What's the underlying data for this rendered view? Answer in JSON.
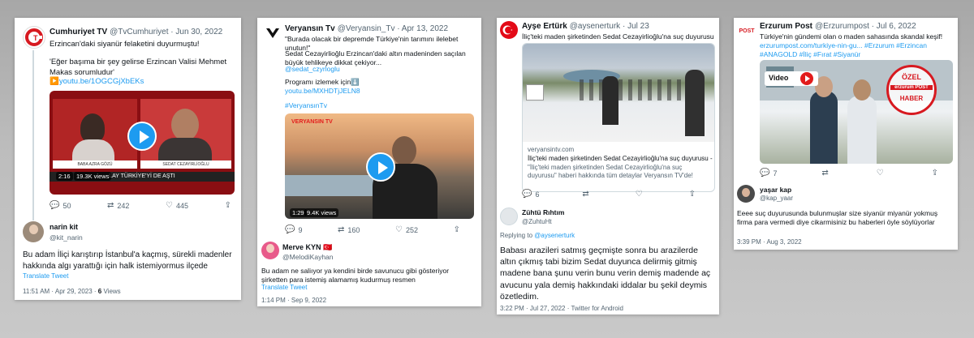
{
  "card1": {
    "name": "Cumhuriyet TV",
    "handle": "@TvCumhuriyet",
    "date": "· Jun 30, 2022",
    "text1": "Erzincan'daki siyanür felaketini duyurmuştu!",
    "text2": "'Eğer başıma bir şey gelirse Erzincan Valisi Mehmet Makas sorumludur'",
    "link": "▶️youtu.be/1OGCGjXbEKs",
    "video_time": "2:16",
    "video_views": "19.3K views",
    "banner_left": "BABA AZRA GÖZÜ",
    "banner_right": "SEDAT CEZAYİRLİOĞLU",
    "ticker": "LAY TÜRKİYE'Yİ DE AŞTI",
    "replies": "50",
    "retweets": "242",
    "likes": "445",
    "reply_name": "narin kit",
    "reply_handle": "@kit_narin",
    "reply_text": "Bu adam İliçi karıştırıp İstanbul'a kaçmış, sürekli madenler hakkında algı yarattığı için halk istemiyormus ilçede",
    "translate": "Translate Tweet",
    "reply_time": "11:51 AM · Apr 29, 2023 · ",
    "reply_views_count": "6",
    "reply_views_label": " Views"
  },
  "card2": {
    "name": "Veryansın Tv",
    "handle": "@Veryansin_Tv",
    "date": "· Apr 13, 2022",
    "quote": "\"Burada olacak bir depremde Türkiye'nin tarımını ilelebet unutun!\"",
    "text": "Sedat Cezayirlioğlu Erzincan'daki altın madeninden saçılan büyük tehlikeye dikkat çekiyor...",
    "mention": "@sedat_czyrloglu",
    "program": "Programı izlemek için⬇️",
    "link": "youtu.be/MXHDTjJELN8",
    "hashtag": "#VeryansınTv",
    "watermark": "VERYANSIN TV",
    "video_time": "1:29",
    "video_views": "9.4K views",
    "replies": "9",
    "retweets": "160",
    "likes": "252",
    "reply_name": "Merve KYN 🇹🇷",
    "reply_handle": "@MelodiKayhan",
    "reply_text": "Bu adam ne saliıyor ya kendini birde savunucu gibi gösteriyor şirketten para istemiş alamamış kudurmuş resmen",
    "translate": "Translate Tweet",
    "reply_time": "1:14 PM · Sep 9, 2022"
  },
  "card3": {
    "name": "Ayşe Ertürk",
    "handle": "@aysenerturk",
    "date": "· Jul 23",
    "text": "İliç'teki maden şirketinden Sedat Cezayirlioğlu'na suç duyurusu",
    "link_domain": "veryansintv.com",
    "link_title": "İliç'teki maden şirketinden Sedat Cezayirlioğlu'na suç duyurusu - ...",
    "link_desc": "\"İliç'teki maden şirketinden Sedat Cezayirlioğlu'na suç duyurusu\" haberi hakkında tüm detaylar Veryansın TV'de!",
    "replies": "6",
    "reply_name": "Zühtü Rıhtım",
    "reply_handle": "@ZuhtuHt",
    "replying_prefix": "Replying to ",
    "replying_to": "@aysenerturk",
    "reply_text": "Babası arazileri satmış geçmişte sonra bu arazilerde altın çıkmış tabi bizim Sedat duyunca delirmiş gitmiş madene bana şunu verin bunu verin demiş madende aç avucunu yala demiş hakkındaki iddalar bu şekil deymis özetledim.",
    "reply_time": "3:22 PM · Jul 27, 2022 · Twitter for Android"
  },
  "card4": {
    "name": "Erzurum Post",
    "handle": "@Erzurumpost",
    "date": "· Jul 6, 2022",
    "text": "Türkiye'nin gündemi olan o maden sahasında skandal keşif!",
    "link": "erzurumpost.com/turkiye-nin-gu... #Erzurum #Erzincan #ANAGOLD #İliç #Fırat #Siyanür",
    "logo_text": "POST",
    "video_label": "Video",
    "stamp_top": "ÖZEL",
    "stamp_mid": "erzurum POST",
    "stamp_bottom": "HABER",
    "replies": "7",
    "reply_name": "yaşar kap",
    "reply_handle": "@kap_yaar",
    "reply_text": "Eeee suç duyurusunda bulunmuşlar size siyanür miyanür yokmuş firma para vermedi diye cikarmisiniz bu haberleri öyle söylüyorlar",
    "reply_time": "3:39 PM · Aug 3, 2022"
  }
}
